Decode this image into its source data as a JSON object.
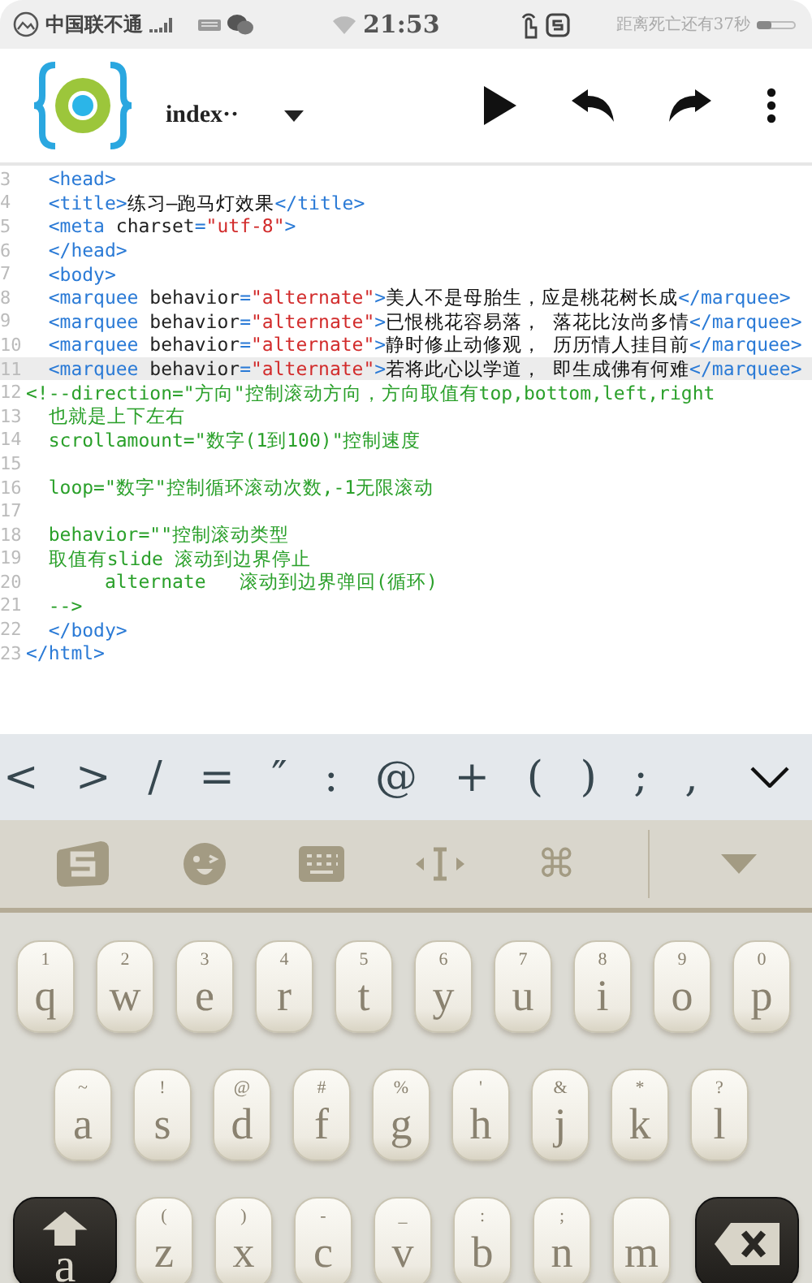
{
  "status_bar": {
    "carrier": "中国联不通",
    "time": "21:53",
    "message": "距离死亡还有37秒"
  },
  "toolbar": {
    "file_name": "index··"
  },
  "editor": {
    "lines": [
      {
        "number": "3",
        "highlighted": false,
        "tokens": [
          {
            "kind": "tag",
            "text": "  <head>"
          }
        ]
      },
      {
        "number": "4",
        "highlighted": false,
        "tokens": [
          {
            "kind": "tag",
            "text": "  <title>"
          },
          {
            "kind": "text",
            "text": "练习—跑马灯效果"
          },
          {
            "kind": "tag",
            "text": "</title>"
          }
        ]
      },
      {
        "number": "5",
        "highlighted": false,
        "tokens": [
          {
            "kind": "tag",
            "text": "  <meta"
          },
          {
            "kind": "attr",
            "text": " charset"
          },
          {
            "kind": "tag",
            "text": "="
          },
          {
            "kind": "value",
            "text": "\"utf-8\""
          },
          {
            "kind": "tag",
            "text": ">"
          }
        ]
      },
      {
        "number": "6",
        "highlighted": false,
        "tokens": [
          {
            "kind": "tag",
            "text": "  </head>"
          }
        ]
      },
      {
        "number": "7",
        "highlighted": false,
        "tokens": [
          {
            "kind": "tag",
            "text": "  <body>"
          }
        ]
      },
      {
        "number": "8",
        "highlighted": false,
        "tokens": [
          {
            "kind": "tag",
            "text": "  <marquee"
          },
          {
            "kind": "attr",
            "text": " behavior"
          },
          {
            "kind": "tag",
            "text": "="
          },
          {
            "kind": "value",
            "text": "\"alternate\""
          },
          {
            "kind": "tag",
            "text": ">"
          },
          {
            "kind": "text",
            "text": "美人不是母胎生，应是桃花树长成"
          },
          {
            "kind": "tag",
            "text": "</marquee>"
          }
        ]
      },
      {
        "number": "9",
        "highlighted": false,
        "tokens": [
          {
            "kind": "tag",
            "text": "  <marquee"
          },
          {
            "kind": "attr",
            "text": " behavior"
          },
          {
            "kind": "tag",
            "text": "="
          },
          {
            "kind": "value",
            "text": "\"alternate\""
          },
          {
            "kind": "tag",
            "text": ">"
          },
          {
            "kind": "text",
            "text": "已恨桃花容易落， 落花比汝尚多情"
          },
          {
            "kind": "tag",
            "text": "</marquee>"
          }
        ]
      },
      {
        "number": "10",
        "highlighted": false,
        "tokens": [
          {
            "kind": "tag",
            "text": "  <marquee"
          },
          {
            "kind": "attr",
            "text": " behavior"
          },
          {
            "kind": "tag",
            "text": "="
          },
          {
            "kind": "value",
            "text": "\"alternate\""
          },
          {
            "kind": "tag",
            "text": ">"
          },
          {
            "kind": "text",
            "text": "静时修止动修观， 历历情人挂目前"
          },
          {
            "kind": "tag",
            "text": "</marquee>"
          }
        ]
      },
      {
        "number": "11",
        "highlighted": true,
        "tokens": [
          {
            "kind": "tag",
            "text": "  <marquee"
          },
          {
            "kind": "attr",
            "text": " behavior"
          },
          {
            "kind": "tag",
            "text": "="
          },
          {
            "kind": "value",
            "text": "\"alternate\""
          },
          {
            "kind": "tag",
            "text": ">"
          },
          {
            "kind": "text",
            "text": "若将此心以学道， 即生成佛有何难"
          },
          {
            "kind": "tag",
            "text": "</marquee>"
          }
        ]
      },
      {
        "number": "12",
        "highlighted": false,
        "tokens": [
          {
            "kind": "comment",
            "text": "<!--direction=\"方向\"控制滚动方向，方向取值有top,bottom,left,right"
          }
        ]
      },
      {
        "number": "13",
        "highlighted": false,
        "tokens": [
          {
            "kind": "comment",
            "text": "  也就是上下左右"
          }
        ]
      },
      {
        "number": "14",
        "highlighted": false,
        "tokens": [
          {
            "kind": "comment",
            "text": "  scrollamount=\"数字(1到100)\"控制速度"
          }
        ]
      },
      {
        "number": "15",
        "highlighted": false
      },
      {
        "number": "16",
        "highlighted": false,
        "tokens": [
          {
            "kind": "comment",
            "text": "  loop=\"数字\"控制循环滚动次数,-1无限滚动"
          }
        ]
      },
      {
        "number": "17",
        "highlighted": false
      },
      {
        "number": "18",
        "highlighted": false,
        "tokens": [
          {
            "kind": "comment",
            "text": "  behavior=\"\"控制滚动类型"
          }
        ]
      },
      {
        "number": "19",
        "highlighted": false,
        "tokens": [
          {
            "kind": "comment",
            "text": "  取值有slide 滚动到边界停止"
          }
        ]
      },
      {
        "number": "20",
        "highlighted": false,
        "tokens": [
          {
            "kind": "comment",
            "text": "       alternate   滚动到边界弹回(循环)"
          }
        ]
      },
      {
        "number": "21",
        "highlighted": false,
        "tokens": [
          {
            "kind": "comment",
            "text": "  -->"
          }
        ]
      },
      {
        "number": "22",
        "highlighted": false,
        "tokens": [
          {
            "kind": "tag",
            "text": "  </body>"
          }
        ]
      },
      {
        "number": "23",
        "highlighted": false,
        "tokens": [
          {
            "kind": "tag",
            "text": "</html>"
          }
        ]
      }
    ]
  },
  "symbol_bar": {
    "keys": [
      "<",
      ">",
      "/",
      "=",
      "″",
      ":",
      "@",
      "+",
      "(",
      ")",
      ";",
      ","
    ]
  },
  "ime_toolbar": {
    "command_key": "⌘"
  },
  "keyboard": {
    "rows": [
      [
        {
          "kind": "letter",
          "hint": "1",
          "label": "q"
        },
        {
          "kind": "letter",
          "hint": "2",
          "label": "w"
        },
        {
          "kind": "letter",
          "hint": "3",
          "label": "e"
        },
        {
          "kind": "letter",
          "hint": "4",
          "label": "r"
        },
        {
          "kind": "letter",
          "hint": "5",
          "label": "t"
        },
        {
          "kind": "letter",
          "hint": "6",
          "label": "y"
        },
        {
          "kind": "letter",
          "hint": "7",
          "label": "u"
        },
        {
          "kind": "letter",
          "hint": "8",
          "label": "i"
        },
        {
          "kind": "letter",
          "hint": "9",
          "label": "o"
        },
        {
          "kind": "letter",
          "hint": "0",
          "label": "p"
        }
      ],
      [
        {
          "kind": "letter",
          "hint": "~",
          "label": "a"
        },
        {
          "kind": "letter",
          "hint": "!",
          "label": "s"
        },
        {
          "kind": "letter",
          "hint": "@",
          "label": "d"
        },
        {
          "kind": "letter",
          "hint": "#",
          "label": "f"
        },
        {
          "kind": "letter",
          "hint": "%",
          "label": "g"
        },
        {
          "kind": "letter",
          "hint": "'",
          "label": "h"
        },
        {
          "kind": "letter",
          "hint": "&",
          "label": "j"
        },
        {
          "kind": "letter",
          "hint": "*",
          "label": "k"
        },
        {
          "kind": "letter",
          "hint": "?",
          "label": "l"
        }
      ],
      [
        {
          "kind": "shift",
          "label": "a"
        },
        {
          "kind": "letter",
          "hint": "(",
          "label": "z"
        },
        {
          "kind": "letter",
          "hint": ")",
          "label": "x"
        },
        {
          "kind": "letter",
          "hint": "-",
          "label": "c"
        },
        {
          "kind": "letter",
          "hint": "_",
          "label": "v"
        },
        {
          "kind": "letter",
          "hint": ":",
          "label": "b"
        },
        {
          "kind": "letter",
          "hint": ";",
          "label": "n"
        },
        {
          "kind": "letter",
          "label": "m"
        },
        {
          "kind": "backspace"
        }
      ]
    ]
  }
}
